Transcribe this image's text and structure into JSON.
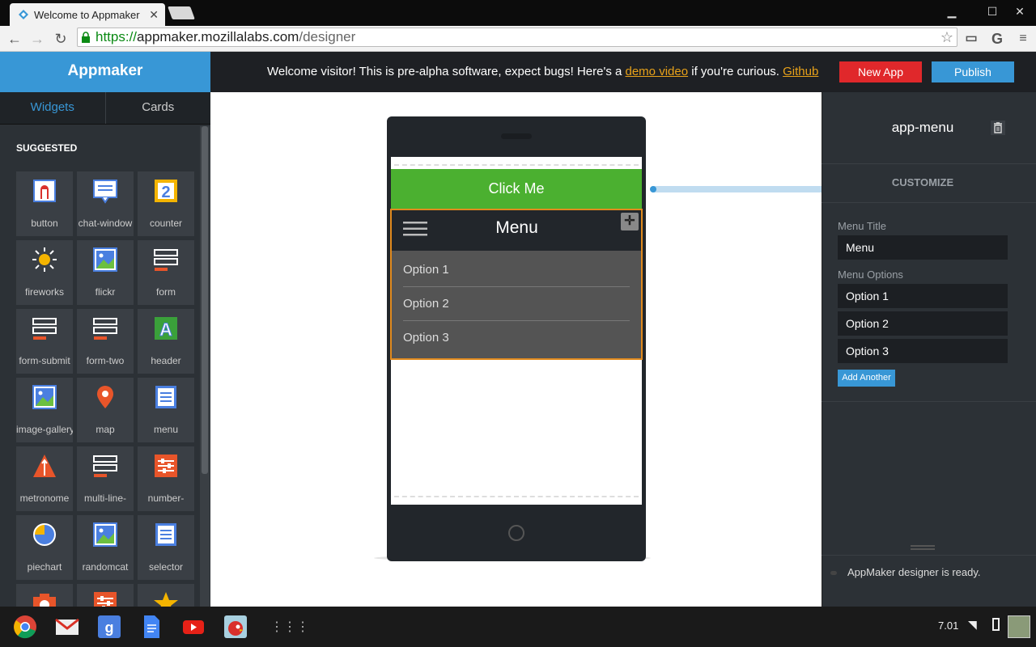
{
  "browser": {
    "tab_title": "Welcome to Appmaker",
    "url_scheme": "https://",
    "url_host": "appmaker.mozillalabs.com",
    "url_path": "/designer"
  },
  "header": {
    "brand": "Appmaker",
    "welcome_prefix": "Welcome visitor! This is pre-alpha software, expect bugs! Here's a ",
    "demo_link": "demo video",
    "welcome_middle": " if you're curious. ",
    "github_link": "Github",
    "new_app": "New App",
    "publish": "Publish"
  },
  "sidebar": {
    "tabs": [
      "Widgets",
      "Cards"
    ],
    "section": "SUGGESTED",
    "widgets": [
      {
        "label": "button",
        "icon": "button-icon"
      },
      {
        "label": "chat-window",
        "icon": "chat-icon"
      },
      {
        "label": "counter",
        "icon": "counter-icon"
      },
      {
        "label": "fireworks",
        "icon": "sun-icon"
      },
      {
        "label": "flickr",
        "icon": "image-icon"
      },
      {
        "label": "form",
        "icon": "form-icon"
      },
      {
        "label": "form-submit",
        "icon": "form-icon"
      },
      {
        "label": "form-two",
        "icon": "form-icon"
      },
      {
        "label": "header",
        "icon": "header-icon"
      },
      {
        "label": "image-gallery",
        "icon": "image-icon"
      },
      {
        "label": "map",
        "icon": "map-pin-icon"
      },
      {
        "label": "menu",
        "icon": "menu-doc-icon"
      },
      {
        "label": "metronome",
        "icon": "metronome-icon"
      },
      {
        "label": "multi-line-",
        "icon": "form-icon"
      },
      {
        "label": "number-",
        "icon": "sliders-icon"
      },
      {
        "label": "piechart",
        "icon": "piechart-icon"
      },
      {
        "label": "randomcat",
        "icon": "image-icon"
      },
      {
        "label": "selector",
        "icon": "menu-doc-icon"
      },
      {
        "label": "",
        "icon": "camera-icon"
      },
      {
        "label": "",
        "icon": "sliders-icon"
      },
      {
        "label": "",
        "icon": "star-icon"
      }
    ]
  },
  "phone": {
    "button_label": "Click Me",
    "menu_title": "Menu",
    "options": [
      "Option 1",
      "Option 2",
      "Option 3"
    ]
  },
  "inspector": {
    "title": "app-menu",
    "section": "CUSTOMIZE",
    "menu_title_label": "Menu Title",
    "menu_title_value": "Menu",
    "menu_options_label": "Menu Options",
    "options": [
      "Option 1",
      "Option 2",
      "Option 3"
    ],
    "add_another": "Add Another",
    "status": "AppMaker designer is ready."
  },
  "shelf": {
    "time": "7.01"
  },
  "colors": {
    "accent": "#3897d6",
    "danger": "#e0282b",
    "button_green": "#4bb030",
    "selection_orange": "#e08a1e"
  }
}
